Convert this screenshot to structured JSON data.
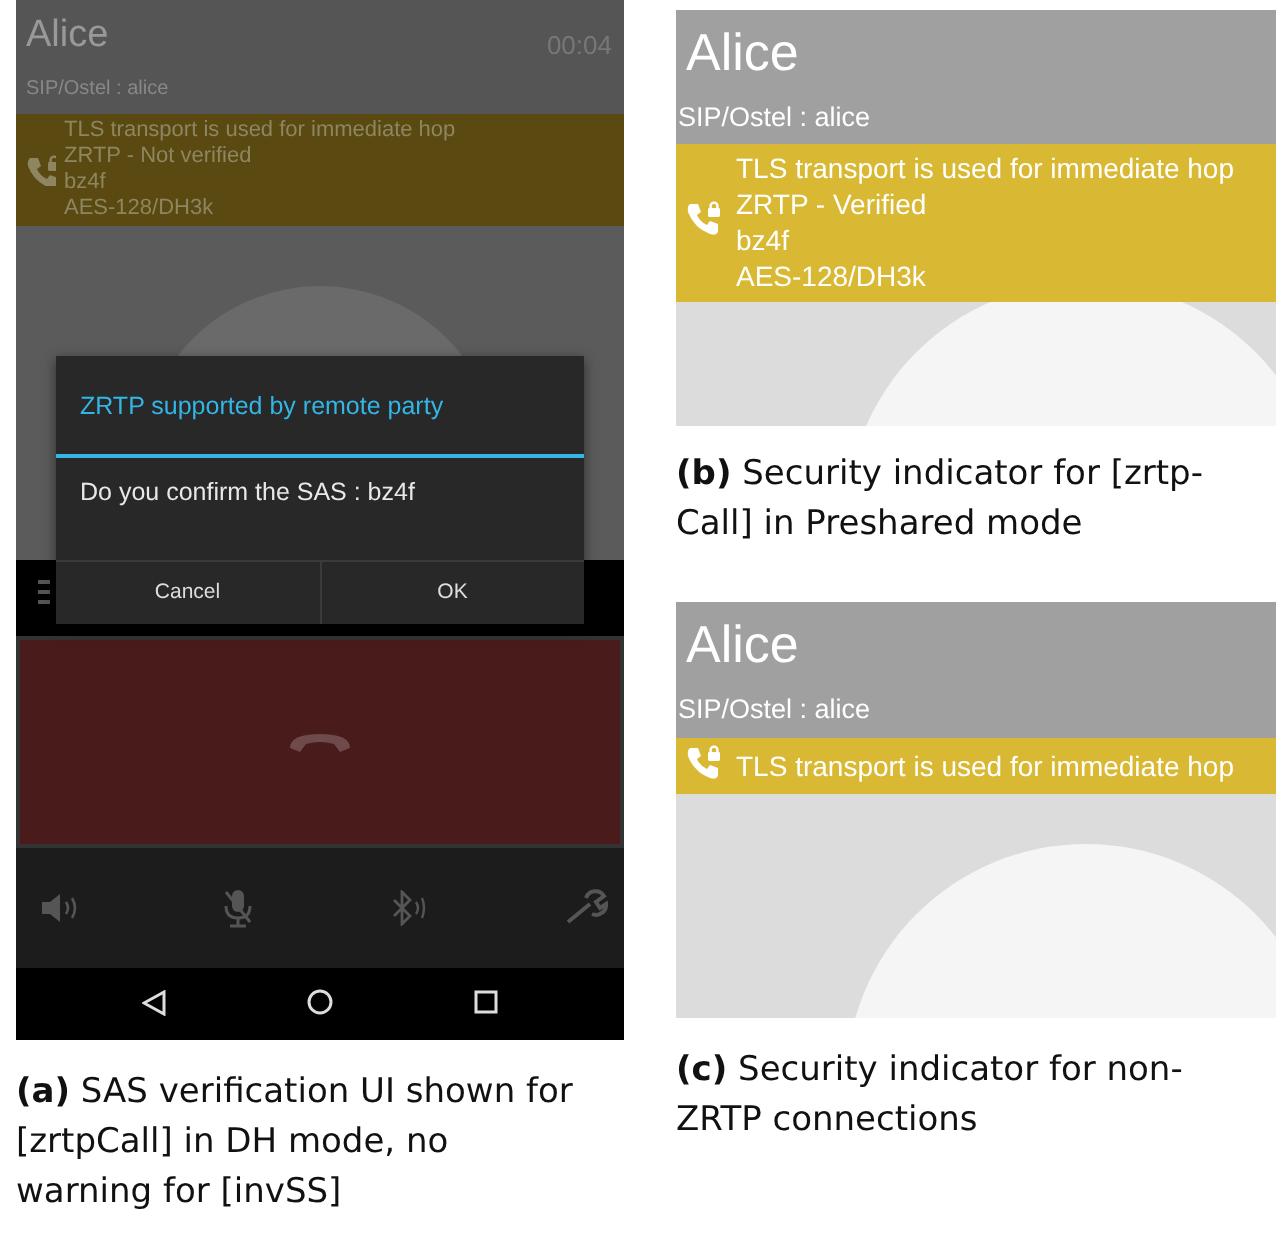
{
  "screens": [
    {
      "kind": "in_call",
      "contact": "Alice",
      "timer": "00:04",
      "account": "SIP/Ostel : alice",
      "security_lines": [
        "TLS transport is used for immediate hop",
        "ZRTP - Not verified",
        "bz4f",
        "AES-128/DH3k"
      ],
      "dialog": {
        "title": "ZRTP supported by remote party",
        "message": "Do you confirm the SAS : bz4f",
        "buttons": [
          "Cancel",
          "OK"
        ]
      },
      "caption": "**(a)** SAS verification UI shown for [zrtpCall] in DH mode, no warning for [invSS]"
    },
    {
      "kind": "header",
      "contact": "Alice",
      "account": "SIP/Ostel : alice",
      "security_lines": [
        "TLS transport is used for immediate hop",
        "ZRTP - Verified",
        "bz4f",
        "AES-128/DH3k"
      ],
      "caption": "**(b)** Security indicator for [zrtp-Call] in Preshared mode"
    },
    {
      "kind": "header",
      "contact": "Alice",
      "account": "SIP/Ostel : alice",
      "security_lines": [
        "TLS transport is used for immediate hop"
      ],
      "caption": "**(c)** Security indicator for non-ZRTP connections"
    }
  ]
}
